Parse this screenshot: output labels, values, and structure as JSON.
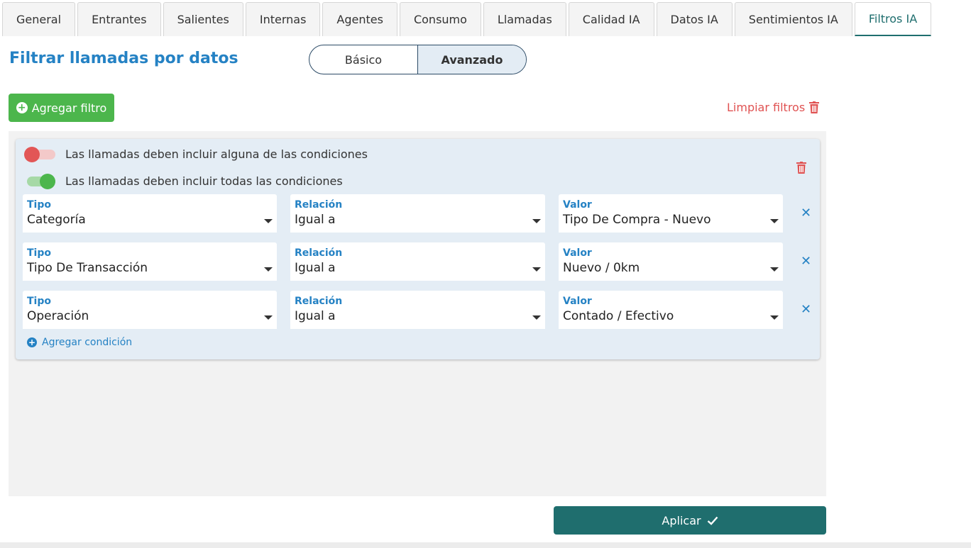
{
  "tabs": [
    {
      "label": "General"
    },
    {
      "label": "Entrantes"
    },
    {
      "label": "Salientes"
    },
    {
      "label": "Internas"
    },
    {
      "label": "Agentes"
    },
    {
      "label": "Consumo"
    },
    {
      "label": "Llamadas"
    },
    {
      "label": "Calidad IA"
    },
    {
      "label": "Datos IA"
    },
    {
      "label": "Sentimientos IA"
    },
    {
      "label": "Filtros IA",
      "active": true
    }
  ],
  "page": {
    "title": "Filtrar llamadas por datos",
    "mode_basic": "Básico",
    "mode_advanced": "Avanzado",
    "add_filter": "Agregar filtro",
    "clear_filters": "Limpiar filtros",
    "apply": "Aplicar"
  },
  "group": {
    "toggle_any": "Las llamadas deben incluir alguna de las condiciones",
    "toggle_all": "Las llamadas deben incluir todas las condiciones",
    "add_condition": "Agregar condición",
    "conditions": [
      {
        "tipo_label": "Tipo",
        "tipo": "Categoría",
        "rel_label": "Relación",
        "rel": "Igual a",
        "valor_label": "Valor",
        "valor": "Tipo De Compra - Nuevo"
      },
      {
        "tipo_label": "Tipo",
        "tipo": "Tipo De Transacción",
        "rel_label": "Relación",
        "rel": "Igual a",
        "valor_label": "Valor",
        "valor": "Nuevo / 0km"
      },
      {
        "tipo_label": "Tipo",
        "tipo": "Operación",
        "rel_label": "Relación",
        "rel": "Igual a",
        "valor_label": "Valor",
        "valor": "Contado / Efectivo"
      }
    ]
  },
  "colors": {
    "accent": "#2582c4",
    "primary": "#1f6e6e",
    "success": "#4cb64c",
    "danger": "#e05252"
  }
}
